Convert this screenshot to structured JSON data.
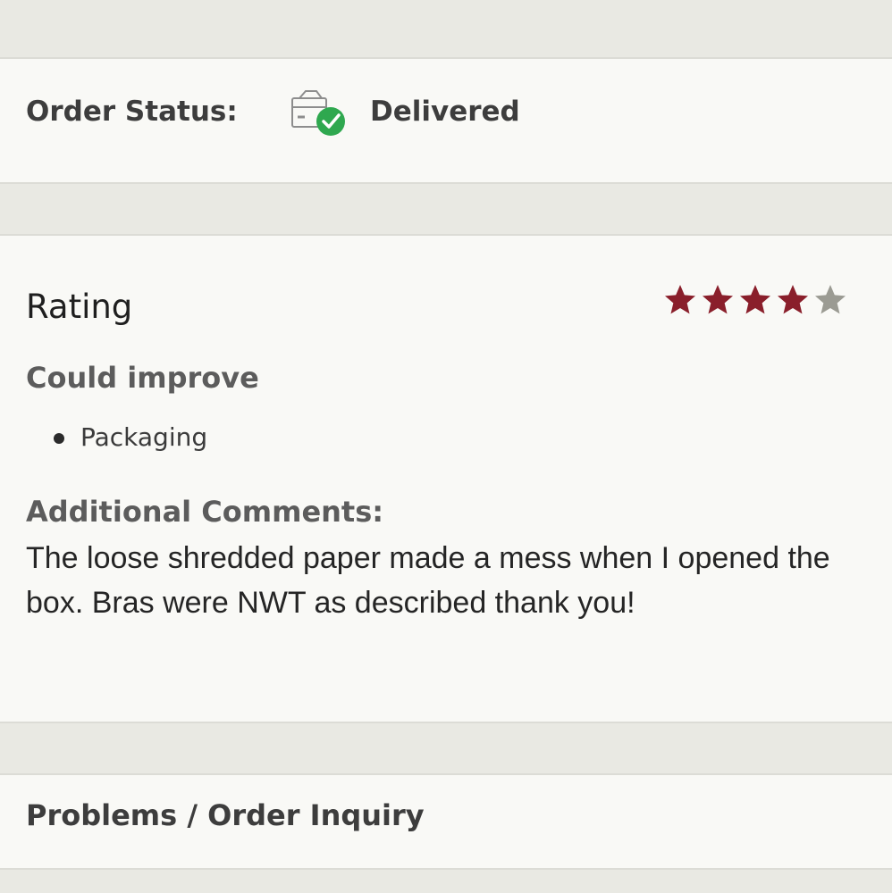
{
  "order": {
    "status_label": "Order Status:",
    "status_value": "Delivered",
    "status_icon": "delivered-box-icon",
    "status_icon_color": "#2fa84f"
  },
  "rating": {
    "title": "Rating",
    "stars_filled": 4,
    "stars_total": 5,
    "filled_color": "#8a1f2b",
    "empty_color": "#9b9b93",
    "could_improve_title": "Could improve",
    "could_improve_items": [
      "Packaging"
    ],
    "comments_title": "Additional Comments:",
    "comments_text": "The loose shredded paper made a mess when I opened the box. Bras were NWT as described thank you!"
  },
  "problems": {
    "title": "Problems / Order Inquiry"
  }
}
